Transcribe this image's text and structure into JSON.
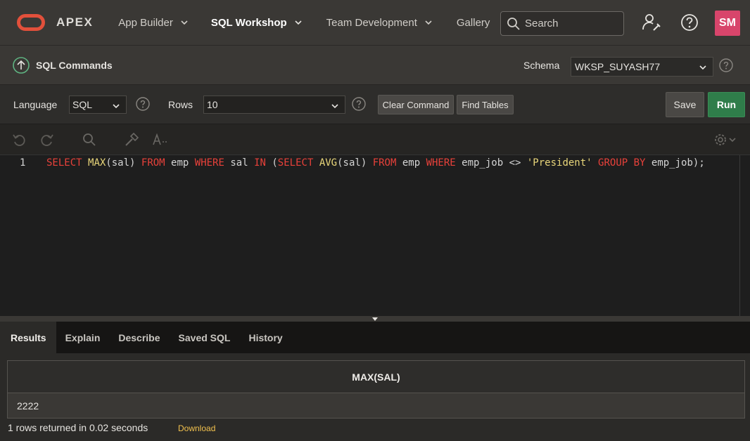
{
  "nav": {
    "brand": "APEX",
    "items": [
      {
        "label": "App Builder"
      },
      {
        "label": "SQL Workshop"
      },
      {
        "label": "Team Development"
      },
      {
        "label": "Gallery"
      }
    ],
    "search_placeholder": "Search",
    "avatar_initials": "SM"
  },
  "titlebar": {
    "title": "SQL Commands",
    "schema_label": "Schema",
    "schema_value": "WKSP_SUYASH77"
  },
  "toolbar": {
    "language_label": "Language",
    "language_value": "SQL",
    "rows_label": "Rows",
    "rows_value": "10",
    "clear_command": "Clear Command",
    "find_tables": "Find Tables",
    "save": "Save",
    "run": "Run"
  },
  "editor": {
    "line_number": "1",
    "code_tokens": [
      {
        "t": "SELECT",
        "c": "kw"
      },
      {
        "t": " "
      },
      {
        "t": "MAX",
        "c": "fn"
      },
      {
        "t": "(sal) "
      },
      {
        "t": "FROM",
        "c": "kw"
      },
      {
        "t": " emp "
      },
      {
        "t": "WHERE",
        "c": "kw"
      },
      {
        "t": " sal "
      },
      {
        "t": "IN",
        "c": "kw"
      },
      {
        "t": " ("
      },
      {
        "t": "SELECT",
        "c": "kw"
      },
      {
        "t": " "
      },
      {
        "t": "AVG",
        "c": "fn"
      },
      {
        "t": "(sal) "
      },
      {
        "t": "FROM",
        "c": "kw"
      },
      {
        "t": " emp "
      },
      {
        "t": "WHERE",
        "c": "kw"
      },
      {
        "t": " emp_job <> "
      },
      {
        "t": "'President'",
        "c": "str"
      },
      {
        "t": " "
      },
      {
        "t": "GROUP BY",
        "c": "kw"
      },
      {
        "t": " emp_job);"
      }
    ]
  },
  "results": {
    "tabs": [
      {
        "label": "Results"
      },
      {
        "label": "Explain"
      },
      {
        "label": "Describe"
      },
      {
        "label": "Saved SQL"
      },
      {
        "label": "History"
      }
    ],
    "column_header": "MAX(SAL)",
    "rows": [
      [
        "2222"
      ]
    ],
    "status": "1 rows returned in 0.02 seconds",
    "download": "Download"
  },
  "colors": {
    "accent_run": "#2f7d4a",
    "logo": "#e2503b",
    "avatar": "#d8456b",
    "keyword": "#e8413a",
    "function": "#e9d67a",
    "download_link": "#f2c14e"
  }
}
